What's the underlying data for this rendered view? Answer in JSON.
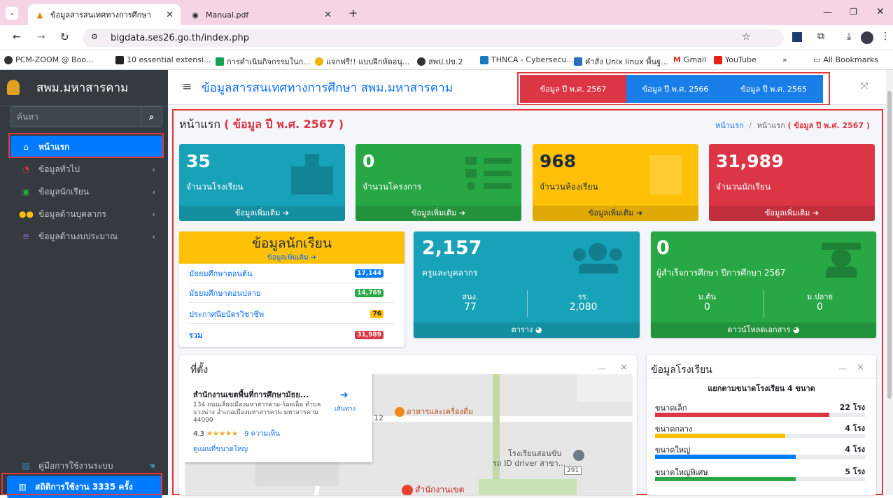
{
  "browser": {
    "tabs": [
      {
        "label": "ข้อมูลสารสนเทศทางการศึกษา"
      },
      {
        "label": "Manual.pdf"
      }
    ],
    "url": "bigdata.ses26.go.th/index.php",
    "bookmarks": [
      "PCM-ZOOM @ Boo...",
      "10 essential extensi...",
      "การดำเนินกิจกรรมในก...",
      "แจกฟรี!! แบบฝึกหัดอนุ...",
      "สพป.ปข.2",
      "THNCA - Cybersecu...",
      "คำสั่ง Unix linux พื้นฐ...",
      "Gmail",
      "YouTube"
    ],
    "all_bookmarks": "All Bookmarks",
    "more": "»"
  },
  "sidebar": {
    "brand": "สพม.มหาสารคาม",
    "search_placeholder": "ค้นหา",
    "items": [
      {
        "label": "หน้าแรก",
        "icon": "home-icon"
      },
      {
        "label": "ข้อมูลทั่วไป",
        "icon": "dashboard-icon"
      },
      {
        "label": "ข้อมูลนักเรียน",
        "icon": "student-icon"
      },
      {
        "label": "ข้อมูลด้านบุคลากร",
        "icon": "users-icon"
      },
      {
        "label": "ข้อมูลด้านงบประมาณ",
        "icon": "coins-icon"
      }
    ],
    "manual": "คู่มือการใช้งานระบบ",
    "stats": "สถิติการใช้งาน 3335 ครั้ง"
  },
  "header": {
    "title": "ข้อมูลสารสนเทศทางการศึกษา สพม.มหาสารคาม",
    "year_tabs": [
      "ข้อมูล ปี พ.ศ. 2567",
      "ข้อมูล ปี พ.ศ. 2566",
      "ข้อมูล ปี พ.ศ. 2565"
    ]
  },
  "page": {
    "title": "หน้าแรก",
    "title_year": "( ข้อมูล ปี พ.ศ. 2567 )",
    "breadcrumb_home": "หน้าแรก",
    "breadcrumb_sep": "/",
    "breadcrumb_current": "หน้าแรก",
    "breadcrumb_year": "( ข้อมูล ปี พ.ศ. 2567 )"
  },
  "stat_boxes": [
    {
      "value": "35",
      "label": "จำนวนโรงเรียน",
      "more": "ข้อมูลเพิ่มเติม",
      "color": "#17a2b8"
    },
    {
      "value": "0",
      "label": "จำนวนโครงการ",
      "more": "ข้อมูลเพิ่มเติม",
      "color": "#28a745"
    },
    {
      "value": "968",
      "label": "จำนวนห้องเรียน",
      "more": "ข้อมูลเพิ่มเติม",
      "color": "#ffc107"
    },
    {
      "value": "31,989",
      "label": "จำนวนนักเรียน",
      "more": "ข้อมูลเพิ่มเติม",
      "color": "#dc3545"
    }
  ],
  "students": {
    "title": "ข้อมูลนักเรียน",
    "more": "ข้อมูลเพิ่มเติม",
    "rows": [
      {
        "label": "มัธยมศึกษาตอนต้น",
        "value": "17,144",
        "color": "#007bff"
      },
      {
        "label": "มัธยมศึกษาตอนปลาย",
        "value": "14,769",
        "color": "#28a745"
      },
      {
        "label": "ประกาศนียบัตรวิชาชีพ",
        "value": "76",
        "color": "#ffc107"
      },
      {
        "label": "รวม",
        "value": "31,989",
        "color": "#dc3545"
      }
    ]
  },
  "staff": {
    "value": "2,157",
    "label": "ครูและบุคลากร",
    "col1_label": "สนง.",
    "col1_value": "77",
    "col2_label": "รร.",
    "col2_value": "2,080",
    "footer": "ตาราง"
  },
  "graduates": {
    "value": "0",
    "label": "ผู้สำเร็จการศึกษา ปีการศึกษา 2567",
    "col1_label": "ม.ต้น",
    "col1_value": "0",
    "col2_label": "ม.ปลาย",
    "col2_value": "0",
    "footer": "ดาวน์โหลดเอกสาร"
  },
  "location": {
    "title": "ที่ตั้ง",
    "minimize": "—",
    "close": "×",
    "place_name": "สำนักงานเขตพื้นที่การศึกษามัธย...",
    "address": "134 ถนนเลี่ยงเมืองมหาสารคาม-ร้อยเอ็ด ตำบล แวงน่าง อำเภอเมืองมหาสารคาม มหาสารคาม 44000",
    "rating": "4.3",
    "stars": "★★★★★",
    "reviews": "9 ความเห็น",
    "directions": "เส้นทาง",
    "larger_map": "ดูแผนที่ขนาดใหญ่",
    "poi1": "อาหารและเครื่องดื่ม",
    "poi2": "โรงเรียนสอนขับ",
    "poi3": "รถ ID driver สาขา...",
    "poi4": "สำนักงานเขต",
    "road": "12",
    "route_num": "291"
  },
  "schools": {
    "title": "ข้อมูลโรงเรียน",
    "minimize": "—",
    "close": "×",
    "subtitle": "แยกตามขนาดโรงเรียน 4 ขนาด",
    "rows": [
      {
        "label": "ขนาดเล็ก",
        "value": "22 โรง",
        "fraction": 0.83,
        "color": "#dc3545"
      },
      {
        "label": "ขนาดกลาง",
        "value": "4 โรง",
        "fraction": 0.62,
        "color": "#ffc107"
      },
      {
        "label": "ขนาดใหญ่",
        "value": "4 โรง",
        "fraction": 0.67,
        "color": "#007bff"
      },
      {
        "label": "ขนาดใหญ่พิเศษ",
        "value": "5 โรง",
        "fraction": 0.67,
        "color": "#28a745"
      }
    ]
  }
}
